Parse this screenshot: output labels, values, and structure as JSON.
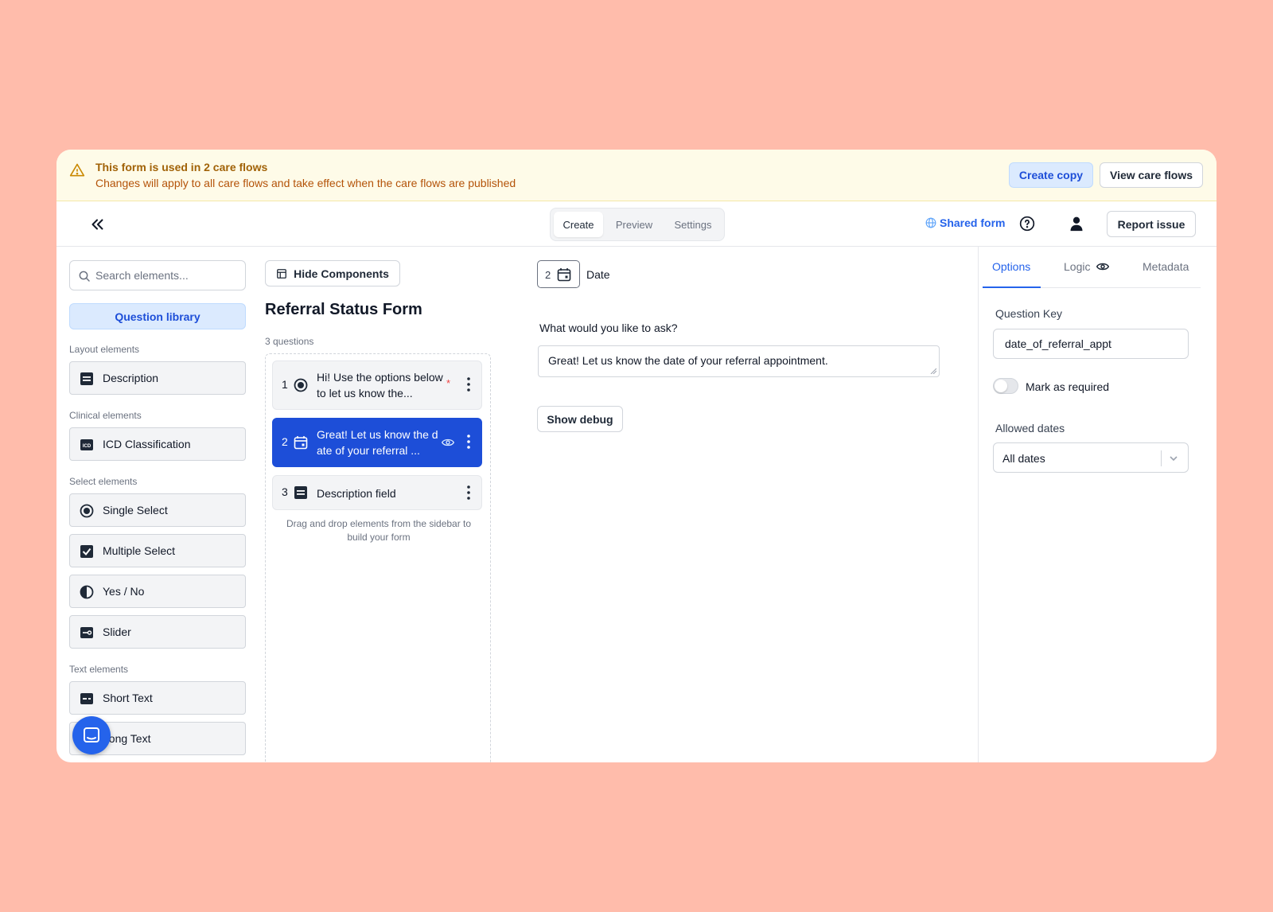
{
  "banner": {
    "title": "This form is used in 2 care flows",
    "subtitle": "Changes will apply to all care flows and take effect when the care flows are published",
    "create_copy": "Create copy",
    "view_flows": "View care flows"
  },
  "topbar": {
    "tabs": [
      "Create",
      "Preview",
      "Settings"
    ],
    "shared_form": "Shared form",
    "report_issue": "Report issue"
  },
  "sidebar": {
    "search_placeholder": "Search elements...",
    "question_library": "Question library",
    "sections": {
      "layout": "Layout elements",
      "clinical": "Clinical elements",
      "select": "Select elements",
      "text": "Text elements"
    },
    "items": {
      "description": "Description",
      "icd": "ICD Classification",
      "single_select": "Single Select",
      "multiple_select": "Multiple Select",
      "yes_no": "Yes / No",
      "slider": "Slider",
      "short_text": "Short Text",
      "long_text": "Long Text"
    }
  },
  "builder": {
    "hide_components": "Hide Components",
    "form_title": "Referral Status Form",
    "question_count": "3 questions",
    "questions": [
      {
        "num": "1",
        "line1": "Hi! Use the options below",
        "line2": "to let us know the...",
        "required": "*"
      },
      {
        "num": "2",
        "line1": "Great! Let us know the d",
        "line2": "ate of your referral ..."
      },
      {
        "num": "3",
        "line1": "Description field"
      }
    ],
    "drag_hint": "Drag and drop elements from the sidebar to build your form"
  },
  "editor": {
    "badge_num": "2",
    "question_type": "Date",
    "ask_label": "What would you like to ask?",
    "ask_value": "Great! Let us know the date of your referral appointment.",
    "show_debug": "Show debug"
  },
  "panel": {
    "tabs": {
      "options": "Options",
      "logic": "Logic",
      "metadata": "Metadata"
    },
    "question_key_label": "Question Key",
    "question_key_value": "date_of_referral_appt",
    "mark_required": "Mark as required",
    "allowed_dates_label": "Allowed dates",
    "allowed_dates_value": "All dates"
  },
  "colors": {
    "background": "#ffbcab",
    "accent": "#1d4ed8",
    "warning_text": "#a16207",
    "banner_bg": "#fefbe8"
  }
}
